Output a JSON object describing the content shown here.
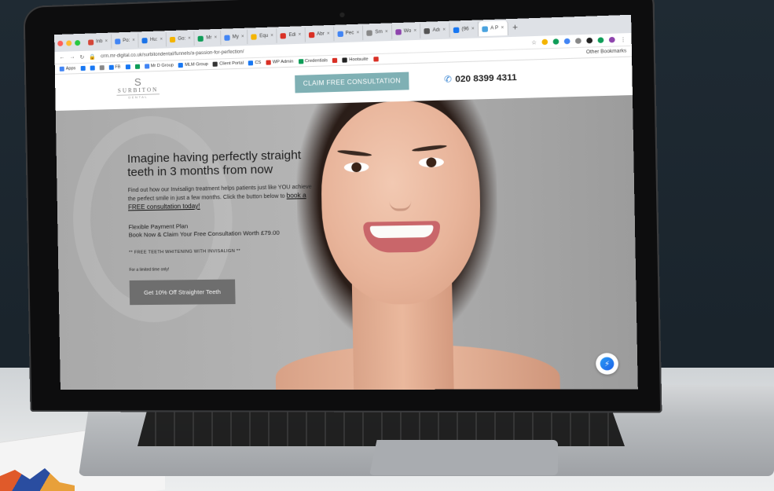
{
  "browser": {
    "tabs": [
      {
        "label": "Inb",
        "color": "#d44638",
        "icon": "gmail-icon"
      },
      {
        "label": "Po:",
        "color": "#4285f4",
        "icon": "doc-icon"
      },
      {
        "label": "Hu:",
        "color": "#1a73e8",
        "icon": "globe-icon"
      },
      {
        "label": "Go:",
        "color": "#f4b400",
        "icon": "shield-icon"
      },
      {
        "label": "Mr",
        "color": "#0f9d58",
        "icon": "drive-icon"
      },
      {
        "label": "My",
        "color": "#4285f4",
        "icon": "drive-icon"
      },
      {
        "label": "Equ",
        "color": "#f4b400",
        "icon": "slides-icon"
      },
      {
        "label": "Edi",
        "color": "#d93025",
        "icon": "d-icon"
      },
      {
        "label": "Abr",
        "color": "#d93025",
        "icon": "d-icon"
      },
      {
        "label": "Pec",
        "color": "#4285f4",
        "icon": "arrow-icon"
      },
      {
        "label": "Sm",
        "color": "#888888",
        "icon": "doc-icon"
      },
      {
        "label": "Wo",
        "color": "#8e44ad",
        "icon": "w-icon"
      },
      {
        "label": "Adı",
        "color": "#555555",
        "icon": "doc-icon"
      },
      {
        "label": "(96",
        "color": "#1877f2",
        "icon": "doc-icon"
      },
      {
        "label": "A P",
        "color": "#4aa3df",
        "icon": "doc-icon"
      }
    ],
    "new_tab": "+",
    "url": "crm.mr-digital.co.uk/surbitondental/funnels/a-passion-for-perfection/",
    "other_bookmarks": "Other Bookmarks",
    "bookmarks": [
      {
        "label": "Apps",
        "color": "#4285f4"
      },
      {
        "label": "",
        "color": "#1877f2"
      },
      {
        "label": "",
        "color": "#1877f2"
      },
      {
        "label": "",
        "color": "#888888"
      },
      {
        "label": "FB",
        "color": "#1877f2"
      },
      {
        "label": "",
        "color": "#1877f2"
      },
      {
        "label": "",
        "color": "#0f9d58"
      },
      {
        "label": "Mr D Group",
        "color": "#4285f4"
      },
      {
        "label": "MLM Group",
        "color": "#1877f2"
      },
      {
        "label": "Client Portal",
        "color": "#333333"
      },
      {
        "label": "CS",
        "color": "#1877f2"
      },
      {
        "label": "WP Admin",
        "color": "#d93025"
      },
      {
        "label": "Credentials",
        "color": "#0f9d58"
      },
      {
        "label": "",
        "color": "#d93025"
      },
      {
        "label": "Hootsuite",
        "color": "#222222"
      },
      {
        "label": "",
        "color": "#d93025"
      }
    ]
  },
  "site": {
    "logo": {
      "name": "SURBITON",
      "sub": "DENTAL",
      "mark": "S"
    },
    "cta_top": "CLAIM FREE CONSULTATION",
    "phone": "020 8399 4311",
    "headline": "Imagine having perfectly straight teeth in 3 months from now",
    "lead": "Find out how our Invisalign treatment helps patients just like YOU achieve the perfect smile in just a few months. Click the button below to ",
    "lead_link": "book a FREE consultation today!",
    "offer_line1": "Flexible Payment Plan",
    "offer_line2": "Book Now & Claim Your Free Consultation Worth £79.00",
    "whitening": "** FREE TEETH WHITENING WITH INVISALIGN **",
    "limited": "For a limited time only!",
    "cta_main": "Get 10% Off Straighter Teeth",
    "messenger_icon": "messenger-icon"
  },
  "colors": {
    "accent": "#7fb0b4",
    "cta_main": "#6e6e6e",
    "phone_icon": "#2d7ed0"
  }
}
